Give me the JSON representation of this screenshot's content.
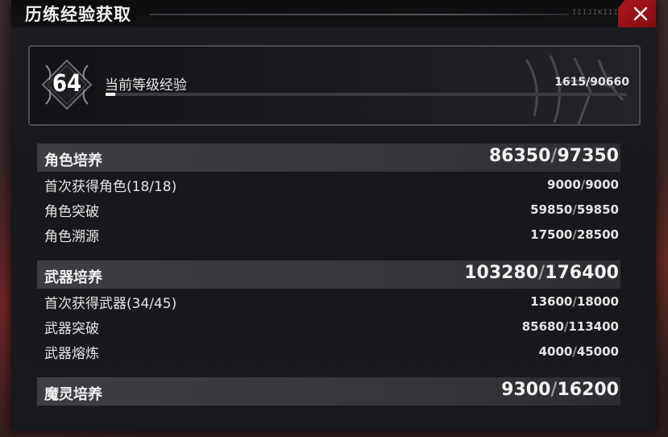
{
  "title": "历练经验获取",
  "title_deco": "IIIJIKIII",
  "level": {
    "number": "64",
    "label": "当前等级经验",
    "current": "1615",
    "max": "90660",
    "progress_fraction": 0.018
  },
  "sections": [
    {
      "name": "角色培养",
      "current": "86350",
      "max": "97350",
      "rows": [
        {
          "name": "首次获得角色(18/18)",
          "current": "9000",
          "max": "9000"
        },
        {
          "name": "角色突破",
          "current": "59850",
          "max": "59850"
        },
        {
          "name": "角色溯源",
          "current": "17500",
          "max": "28500"
        }
      ]
    },
    {
      "name": "武器培养",
      "current": "103280",
      "max": "176400",
      "rows": [
        {
          "name": "首次获得武器(34/45)",
          "current": "13600",
          "max": "18000"
        },
        {
          "name": "武器突破",
          "current": "85680",
          "max": "113400"
        },
        {
          "name": "武器熔炼",
          "current": "4000",
          "max": "45000"
        }
      ]
    },
    {
      "name": "魔灵培养",
      "current": "9300",
      "max": "16200",
      "rows": []
    }
  ],
  "separator": "/",
  "colors": {
    "close_button": "#b1161c",
    "panel": "#1a1b1f",
    "section_header": "#3a3b41"
  },
  "icons": {
    "close": "close-icon",
    "level_emblem": "level-emblem-icon"
  }
}
